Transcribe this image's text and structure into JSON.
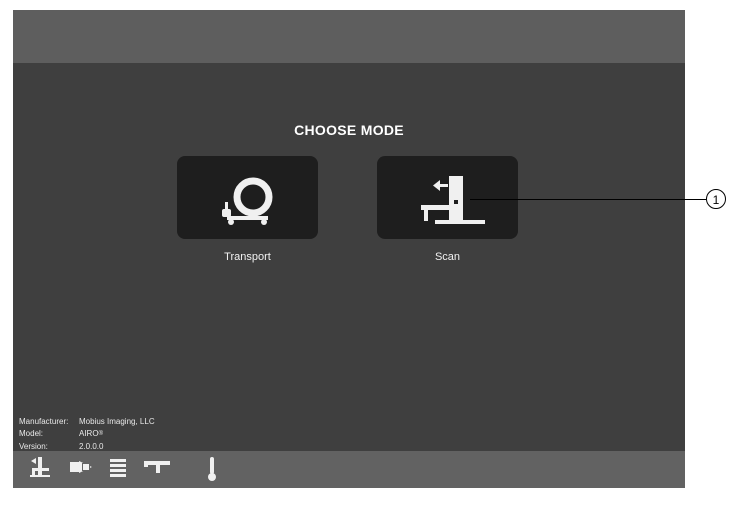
{
  "screen": {
    "title": "CHOOSE MODE",
    "modes": [
      {
        "label": "Transport",
        "icon": "transport-gantry-icon"
      },
      {
        "label": "Scan",
        "icon": "scan-gantry-icon"
      }
    ],
    "info": {
      "manufacturer_label": "Manufacturer:",
      "manufacturer_value": "Mobius Imaging, LLC",
      "model_label": "Model:",
      "model_value": "AIRO",
      "model_mark": "®",
      "version_label": "Version:",
      "version_value": "2.0.0.0"
    },
    "status_icons": [
      "table-position-icon",
      "transfer-icon",
      "battery-stack-icon",
      "laser-icon",
      "thermometer-icon"
    ]
  },
  "callout": {
    "number": "1"
  },
  "colors": {
    "screen_bg": "#3f3f3f",
    "bar_bg": "#5e5e5e",
    "button_bg": "#1e1e1e",
    "icon_fg": "#f0f0f0"
  }
}
